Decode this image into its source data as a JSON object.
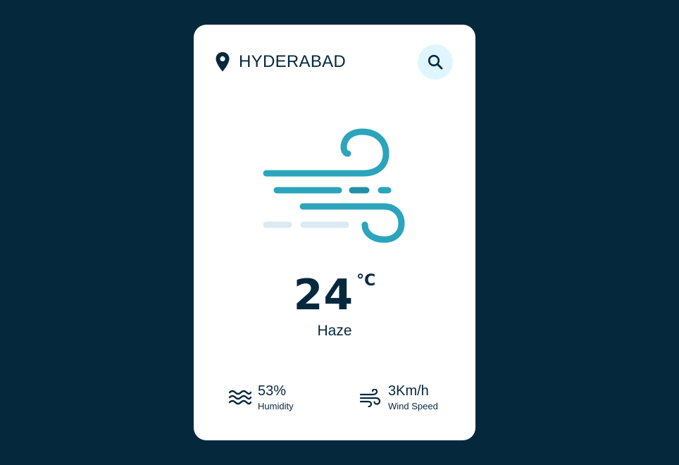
{
  "location": {
    "city": "HYDERABAD",
    "icon": "map-pin-icon"
  },
  "search": {
    "icon": "search-icon"
  },
  "weather": {
    "icon": "wind-icon",
    "temperature": "24",
    "unit": "°C",
    "description": "Haze"
  },
  "details": {
    "humidity": {
      "value": "53%",
      "label": "Humidity",
      "icon": "humidity-waves-icon"
    },
    "wind": {
      "value": "3Km/h",
      "label": "Wind Speed",
      "icon": "wind-speed-icon"
    }
  },
  "colors": {
    "background": "#06283d",
    "card": "#ffffff",
    "text": "#06283d",
    "search_bg": "#dff6ff",
    "accent": "#2ba4bc"
  }
}
